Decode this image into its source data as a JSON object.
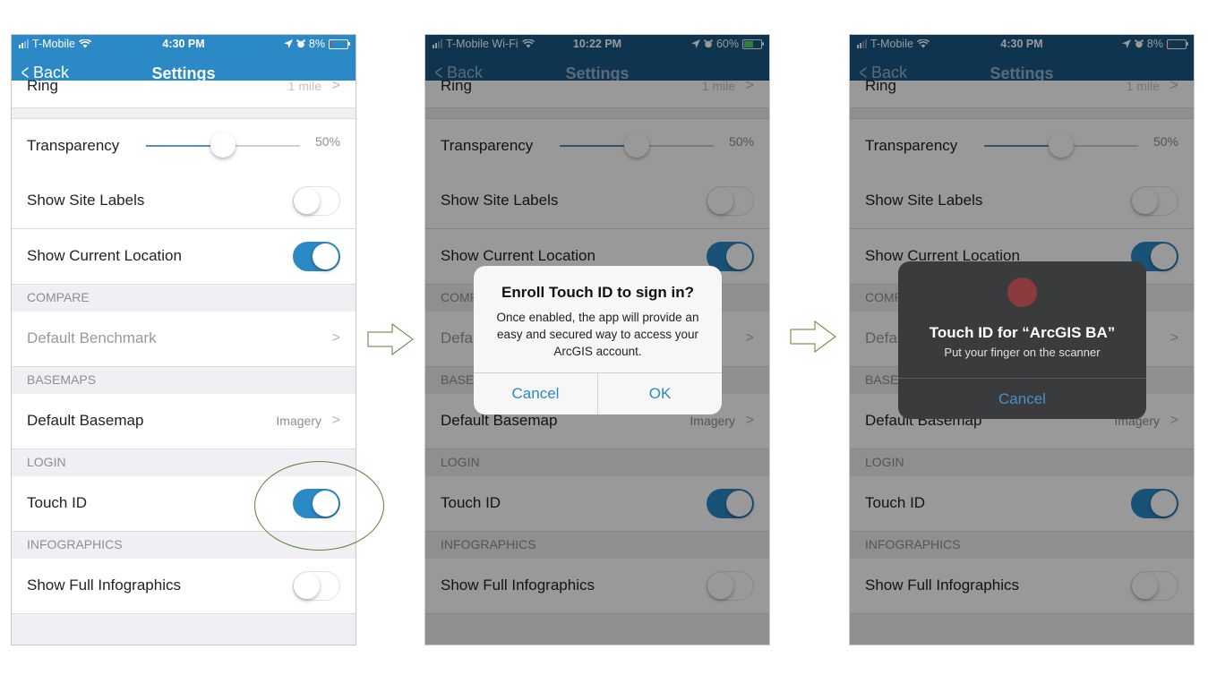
{
  "colors": {
    "nav_active": "#2b89c6",
    "nav_dimmed": "#1a5784",
    "toggle_on": "#2b89c6",
    "arrow_stroke": "#548235",
    "highlight_ring": "#548235"
  },
  "screens": [
    {
      "status": {
        "carrier": "T-Mobile",
        "time": "4:30 PM",
        "battery": "8%",
        "battery_level": 0.08,
        "charging": false
      },
      "nav": {
        "back_label": "Back",
        "title": "Settings"
      },
      "dimmed": false
    },
    {
      "status": {
        "carrier": "T-Mobile Wi-Fi",
        "time": "10:22 PM",
        "battery": "60%",
        "battery_level": 0.6,
        "charging": true
      },
      "nav": {
        "back_label": "Back",
        "title": "Settings"
      },
      "dimmed": true,
      "alert": {
        "title": "Enroll Touch ID to sign in?",
        "message": "Once enabled, the app will provide an easy and secured way to access your ArcGIS account.",
        "cancel_label": "Cancel",
        "ok_label": "OK"
      }
    },
    {
      "status": {
        "carrier": "T-Mobile",
        "time": "4:30 PM",
        "battery": "8%",
        "battery_level": 0.08,
        "charging": false
      },
      "nav": {
        "back_label": "Back",
        "title": "Settings"
      },
      "dimmed": true,
      "touchid_prompt": {
        "icon": "fingerprint-icon",
        "title": "Touch ID for “ArcGIS BA”",
        "subtitle": "Put your finger on the scanner",
        "cancel_label": "Cancel"
      }
    }
  ],
  "settings": {
    "ring": {
      "label": "Ring",
      "value": "1 mile"
    },
    "transparency": {
      "label": "Transparency",
      "value_label": "50%",
      "value": 0.5
    },
    "show_site_labels": {
      "label": "Show Site Labels",
      "on": false
    },
    "show_current_location": {
      "label": "Show Current Location",
      "on": true
    },
    "compare_header": "COMPARE",
    "default_benchmark": {
      "label": "Default Benchmark"
    },
    "basemaps_header": "BASEMAPS",
    "default_basemap": {
      "label": "Default Basemap",
      "value": "Imagery"
    },
    "login_header": "LOGIN",
    "touch_id": {
      "label": "Touch ID",
      "on": true
    },
    "infographics_header": "INFOGRAPHICS",
    "show_full_infographics": {
      "label": "Show Full Infographics",
      "on": false
    }
  }
}
